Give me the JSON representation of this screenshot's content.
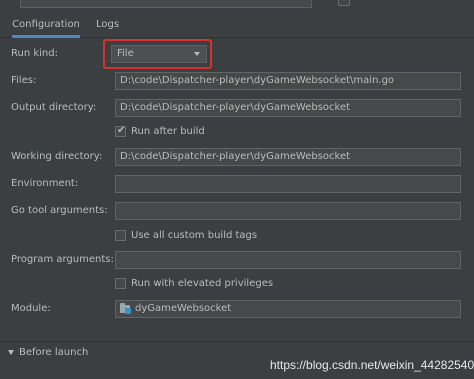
{
  "tabs": [
    {
      "label": "Configuration",
      "active": true
    },
    {
      "label": "Logs",
      "active": false
    }
  ],
  "form": {
    "run_kind": {
      "label": "Run kind:",
      "value": "File"
    },
    "files": {
      "label": "Files:",
      "value": "D:\\code\\Dispatcher-player\\dyGameWebsocket\\main.go"
    },
    "output_directory": {
      "label": "Output directory:",
      "value": "D:\\code\\Dispatcher-player\\dyGameWebsocket"
    },
    "run_after_build": {
      "label": "Run after build",
      "checked": true
    },
    "working_directory": {
      "label": "Working directory:",
      "value": "D:\\code\\Dispatcher-player\\dyGameWebsocket"
    },
    "environment": {
      "label": "Environment:",
      "value": ""
    },
    "go_tool_arguments": {
      "label": "Go tool arguments:",
      "value": ""
    },
    "use_all_custom_build_tags": {
      "label": "Use all custom build tags",
      "checked": false
    },
    "program_arguments": {
      "label": "Program arguments:",
      "value": ""
    },
    "run_with_elevated_privileges": {
      "label": "Run with elevated privileges",
      "checked": false
    },
    "module": {
      "label": "Module:",
      "value": "dyGameWebsocket",
      "icon": "module-folder-icon"
    }
  },
  "before_launch": {
    "label": "Before launch"
  },
  "watermark": "https://blog.csdn.net/weixin_44282540",
  "colors": {
    "background": "#3c3f41",
    "accent": "#4a88c7",
    "highlight_box": "#d9302c"
  }
}
